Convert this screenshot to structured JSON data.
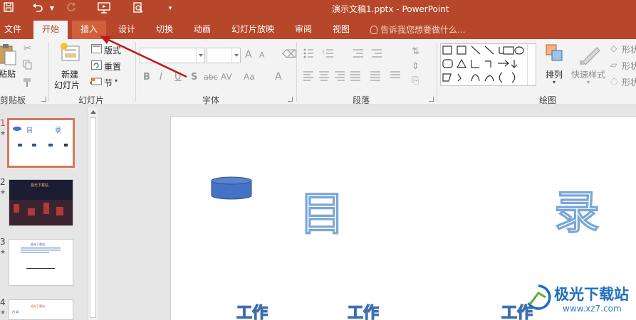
{
  "window": {
    "doc_title": "演示文稿1.pptx - PowerPoint",
    "quick_access": [
      "save-icon",
      "undo-icon",
      "redo-icon",
      "start-from-beginning-icon",
      "print-preview-icon",
      "customize-icon"
    ]
  },
  "tabs": [
    {
      "label": "文件"
    },
    {
      "label": "开始"
    },
    {
      "label": "插入"
    },
    {
      "label": "设计"
    },
    {
      "label": "切换"
    },
    {
      "label": "动画"
    },
    {
      "label": "幻灯片放映"
    },
    {
      "label": "审阅"
    },
    {
      "label": "视图"
    }
  ],
  "active_tab": "开始",
  "highlighted_tab": "插入",
  "tell_me": "告诉我您想要做什么...",
  "ribbon": {
    "clipboard": {
      "paste_label": "粘贴",
      "group_label": "剪贴板"
    },
    "slides": {
      "new_slide_label_1": "新建",
      "new_slide_label_2": "幻灯片",
      "layout_label": "版式",
      "reset_label": "重置",
      "section_label": "节",
      "group_label": "幻灯片"
    },
    "font": {
      "font_name": "",
      "font_size": "",
      "bold": "B",
      "italic": "I",
      "underline": "U",
      "shadow": "S",
      "strike": "abc",
      "spacing": "AV",
      "case": "Aa",
      "color": "A",
      "grow": "A",
      "shrink": "A",
      "group_label": "字体"
    },
    "paragraph": {
      "group_label": "段落"
    },
    "drawing": {
      "arrange_label": "排列",
      "quick_styles_label": "快速样式",
      "shape_fill_label": "形状",
      "shape_outline_label": "形状",
      "shape_effect_label": "形状",
      "group_label": "绘图"
    }
  },
  "thumbnails": [
    {
      "number": "1",
      "star": "★",
      "selected": true,
      "title_left": "目",
      "title_right": "录"
    },
    {
      "number": "2",
      "star": "★",
      "selected": false,
      "title": "极光下载站"
    },
    {
      "number": "3",
      "star": "★",
      "selected": false,
      "title": "极光下载站"
    },
    {
      "number": "4",
      "star": "★",
      "selected": false,
      "title": "极光下载站",
      "subtitle": "目 录"
    }
  ],
  "slide": {
    "char_left": "目",
    "char_right": "录",
    "work_items": [
      "工作",
      "工作",
      "工作"
    ]
  },
  "watermark": {
    "text": "极光下载站",
    "url": "www.xz7.com"
  },
  "colors": {
    "accent": "#b7472a",
    "tab_highlight": "#d25f3c",
    "shape_fill": "#4472c4",
    "arrow": "#c0191c",
    "text_outline": "#7aa7d8"
  }
}
